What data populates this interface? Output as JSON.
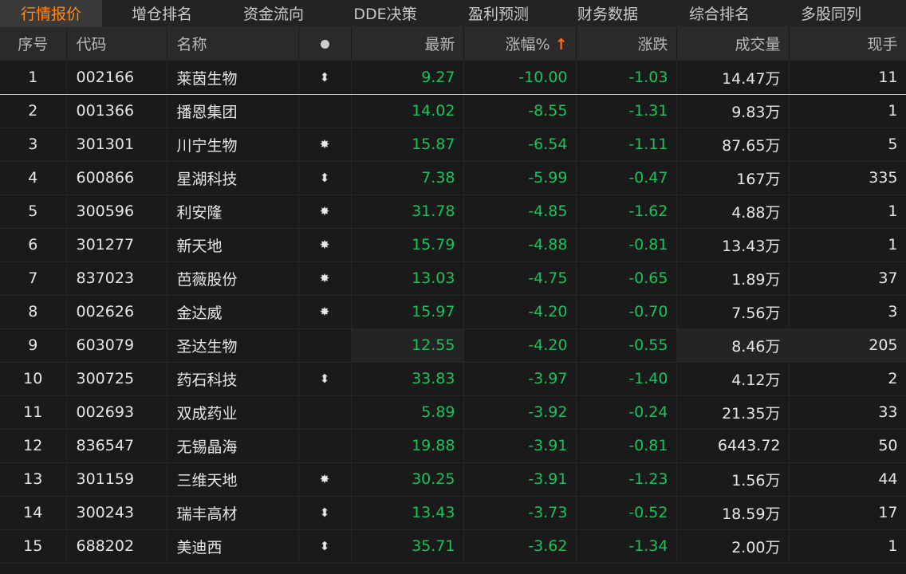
{
  "tabs": [
    "行情报价",
    "增仓排名",
    "资金流向",
    "DDE决策",
    "盈利预测",
    "财务数据",
    "综合排名",
    "多股同列"
  ],
  "columns": {
    "index": "序号",
    "code": "代码",
    "name": "名称",
    "latest": "最新",
    "change_pct": "涨幅%",
    "sort_arrow": "↑",
    "change": "涨跌",
    "volume": "成交量",
    "current": "现手"
  },
  "rows": [
    {
      "idx": "1",
      "code": "002166",
      "name": "莱茵生物",
      "mark": "⬍",
      "latest": "9.27",
      "pct": "-10.00",
      "chg": "-1.03",
      "vol": "14.47万",
      "cur": "11"
    },
    {
      "idx": "2",
      "code": "001366",
      "name": "播恩集团",
      "mark": "",
      "latest": "14.02",
      "pct": "-8.55",
      "chg": "-1.31",
      "vol": "9.83万",
      "cur": "1"
    },
    {
      "idx": "3",
      "code": "301301",
      "name": "川宁生物",
      "mark": "✸",
      "latest": "15.87",
      "pct": "-6.54",
      "chg": "-1.11",
      "vol": "87.65万",
      "cur": "5"
    },
    {
      "idx": "4",
      "code": "600866",
      "name": "星湖科技",
      "mark": "⬍",
      "latest": "7.38",
      "pct": "-5.99",
      "chg": "-0.47",
      "vol": "167万",
      "cur": "335"
    },
    {
      "idx": "5",
      "code": "300596",
      "name": "利安隆",
      "mark": "✸",
      "latest": "31.78",
      "pct": "-4.85",
      "chg": "-1.62",
      "vol": "4.88万",
      "cur": "1"
    },
    {
      "idx": "6",
      "code": "301277",
      "name": "新天地",
      "mark": "✸",
      "latest": "15.79",
      "pct": "-4.88",
      "chg": "-0.81",
      "vol": "13.43万",
      "cur": "1"
    },
    {
      "idx": "7",
      "code": "837023",
      "name": "芭薇股份",
      "mark": "✸",
      "latest": "13.03",
      "pct": "-4.75",
      "chg": "-0.65",
      "vol": "1.89万",
      "cur": "37"
    },
    {
      "idx": "8",
      "code": "002626",
      "name": "金达威",
      "mark": "✸",
      "latest": "15.97",
      "pct": "-4.20",
      "chg": "-0.70",
      "vol": "7.56万",
      "cur": "3"
    },
    {
      "idx": "9",
      "code": "603079",
      "name": "圣达生物",
      "mark": "",
      "latest": "12.55",
      "pct": "-4.20",
      "chg": "-0.55",
      "vol": "8.46万",
      "cur": "205"
    },
    {
      "idx": "10",
      "code": "300725",
      "name": "药石科技",
      "mark": "⬍",
      "latest": "33.83",
      "pct": "-3.97",
      "chg": "-1.40",
      "vol": "4.12万",
      "cur": "2"
    },
    {
      "idx": "11",
      "code": "002693",
      "name": "双成药业",
      "mark": "",
      "latest": "5.89",
      "pct": "-3.92",
      "chg": "-0.24",
      "vol": "21.35万",
      "cur": "33"
    },
    {
      "idx": "12",
      "code": "836547",
      "name": "无锡晶海",
      "mark": "",
      "latest": "19.88",
      "pct": "-3.91",
      "chg": "-0.81",
      "vol": "6443.72",
      "cur": "50"
    },
    {
      "idx": "13",
      "code": "301159",
      "name": "三维天地",
      "mark": "✸",
      "latest": "30.25",
      "pct": "-3.91",
      "chg": "-1.23",
      "vol": "1.56万",
      "cur": "44"
    },
    {
      "idx": "14",
      "code": "300243",
      "name": "瑞丰高材",
      "mark": "⬍",
      "latest": "13.43",
      "pct": "-3.73",
      "chg": "-0.52",
      "vol": "18.59万",
      "cur": "17"
    },
    {
      "idx": "15",
      "code": "688202",
      "name": "美迪西",
      "mark": "⬍",
      "latest": "35.71",
      "pct": "-3.62",
      "chg": "-1.34",
      "vol": "2.00万",
      "cur": "1"
    }
  ]
}
